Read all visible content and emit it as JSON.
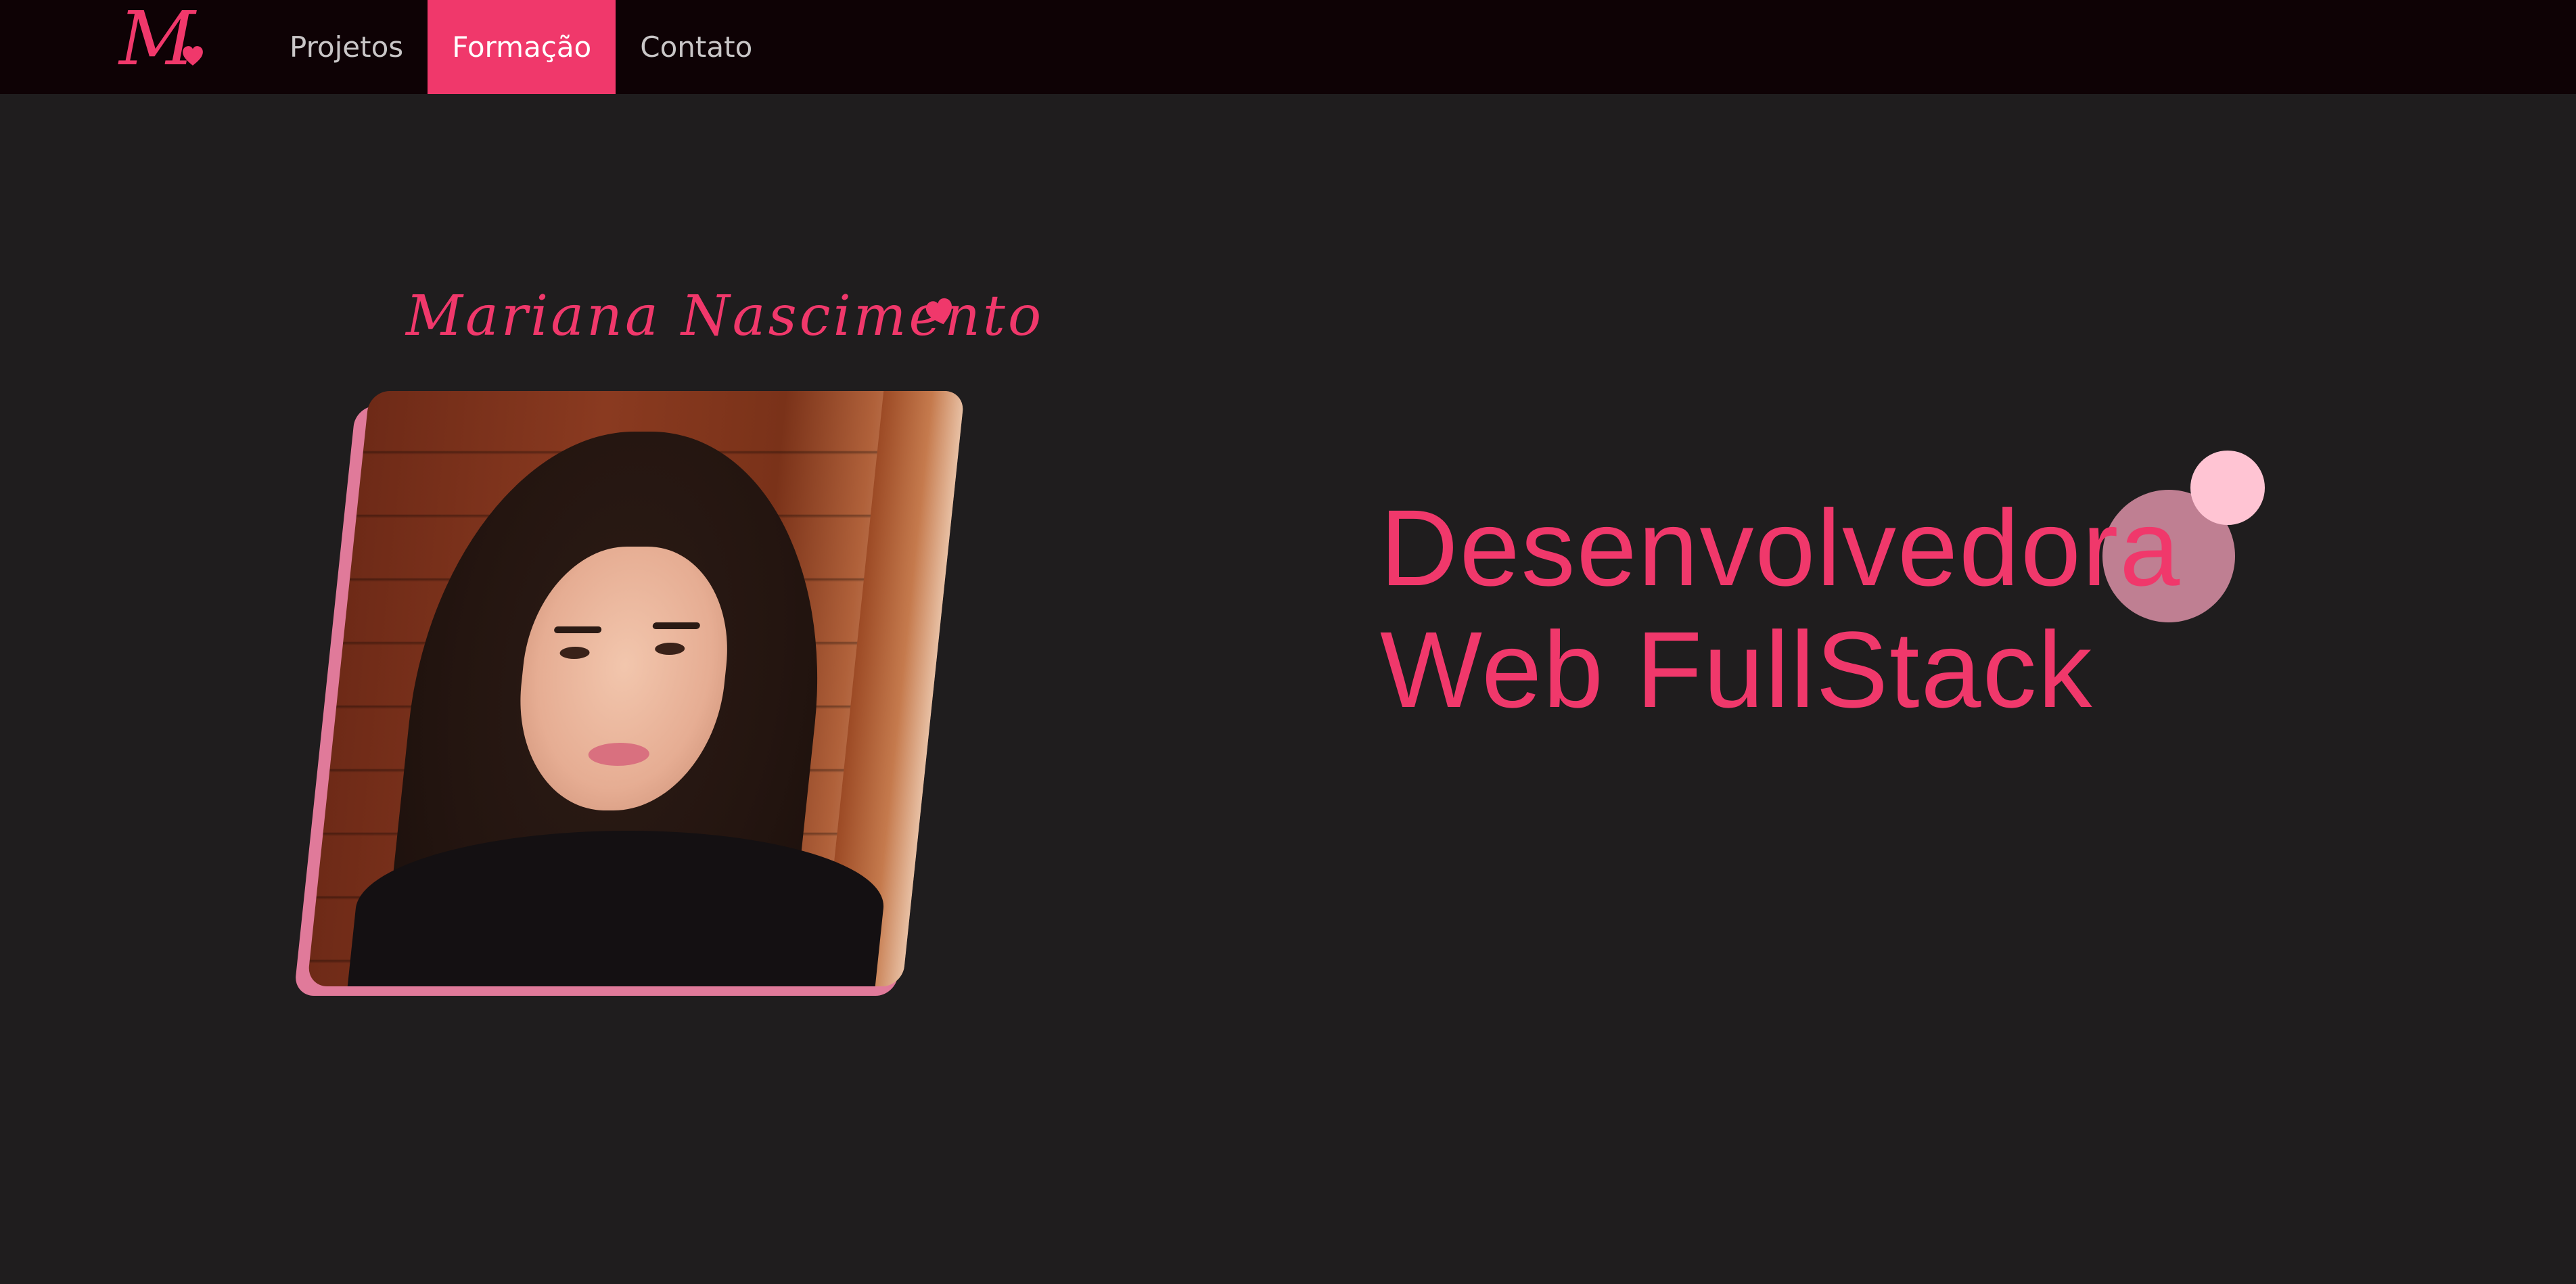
{
  "colors": {
    "background": "#1f1d1e",
    "navbar": "#0e0205",
    "accent": "#f0386b",
    "photo_border": "#e07a9a",
    "bubble_light": "#ffc4d3",
    "bubble_mid": "#f5a0b9"
  },
  "header": {
    "logo_letter": "M",
    "logo_icon": "heart-icon",
    "nav": [
      {
        "label": "Projetos",
        "active": false
      },
      {
        "label": "Formação",
        "active": true
      },
      {
        "label": "Contato",
        "active": false
      }
    ]
  },
  "profile": {
    "name": "Mariana Nascimento",
    "name_icon": "heart-icon",
    "photo_alt": "profile-photo"
  },
  "hero": {
    "line1": "Desenvolvedora",
    "line2": "Web FullStack"
  }
}
